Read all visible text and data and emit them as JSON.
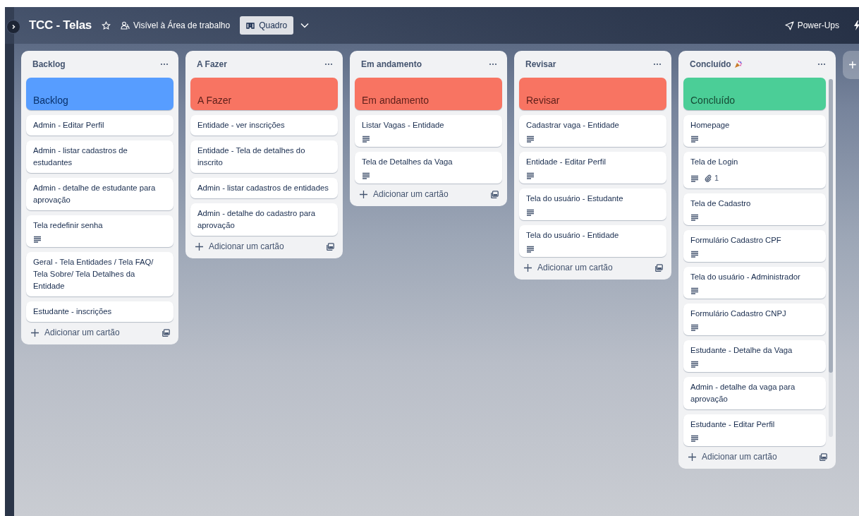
{
  "board": {
    "title": "TCC - Telas",
    "visibility": "Visível à Área de trabalho",
    "view": "Quadro",
    "power_ups": "Power-Ups"
  },
  "lists": [
    {
      "title": "Backlog",
      "celebration_icon": false,
      "scrollbar": false,
      "add_label": "Adicionar um cartão",
      "cards": [
        {
          "kind": "cover",
          "title": "Backlog",
          "color": "#579dff"
        },
        {
          "kind": "task",
          "title": "Admin - Editar Perfil",
          "description": false
        },
        {
          "kind": "task",
          "title": "Admin - listar cadastros de estudantes",
          "description": false
        },
        {
          "kind": "task",
          "title": "Admin - detalhe de estudante para aprovação",
          "description": false
        },
        {
          "kind": "task",
          "title": "Tela redefinir senha",
          "description": true
        },
        {
          "kind": "task",
          "title": "Geral - Tela Entidades / Tela FAQ/ Tela Sobre/ Tela Detalhes da Entidade",
          "description": false
        },
        {
          "kind": "task",
          "title": "Estudante - inscrições",
          "description": false
        }
      ]
    },
    {
      "title": "A Fazer",
      "celebration_icon": false,
      "scrollbar": false,
      "add_label": "Adicionar um cartão",
      "cards": [
        {
          "kind": "cover",
          "title": "A Fazer",
          "color": "#f87462"
        },
        {
          "kind": "task",
          "title": "Entidade - ver inscrições",
          "description": false
        },
        {
          "kind": "task",
          "title": "Entidade - Tela de detalhes do inscrito",
          "description": false
        },
        {
          "kind": "task",
          "title": "Admin - listar cadastros de entidades",
          "description": false
        },
        {
          "kind": "task",
          "title": "Admin - detalhe do cadastro para aprovação",
          "description": false
        }
      ]
    },
    {
      "title": "Em andamento",
      "celebration_icon": false,
      "scrollbar": false,
      "add_label": "Adicionar um cartão",
      "cards": [
        {
          "kind": "cover",
          "title": "Em andamento",
          "color": "#f87462"
        },
        {
          "kind": "task",
          "title": "Listar Vagas - Entidade",
          "description": true
        },
        {
          "kind": "task",
          "title": "Tela de Detalhes da Vaga",
          "description": true
        }
      ]
    },
    {
      "title": "Revisar",
      "celebration_icon": false,
      "scrollbar": false,
      "add_label": "Adicionar um cartão",
      "cards": [
        {
          "kind": "cover",
          "title": "Revisar",
          "color": "#f87462"
        },
        {
          "kind": "task",
          "title": "Cadastrar vaga - Entidade",
          "description": true
        },
        {
          "kind": "task",
          "title": "Entidade - Editar Perfil",
          "description": true
        },
        {
          "kind": "task",
          "title": "Tela do usuário - Estudante",
          "description": true
        },
        {
          "kind": "task",
          "title": "Tela do usuário - Entidade",
          "description": true
        }
      ]
    },
    {
      "title": "Concluído",
      "celebration_icon": true,
      "scrollbar": true,
      "add_label": "Adicionar um cartão",
      "cards": [
        {
          "kind": "cover",
          "title": "Concluído",
          "color": "#4bce97"
        },
        {
          "kind": "task",
          "title": "Homepage",
          "description": true
        },
        {
          "kind": "task",
          "title": "Tela de Login",
          "description": true,
          "attachments": "1"
        },
        {
          "kind": "task",
          "title": "Tela de Cadastro",
          "description": true
        },
        {
          "kind": "task",
          "title": "Formulário Cadastro CPF",
          "description": true
        },
        {
          "kind": "task",
          "title": "Tela do usuário - Administrador",
          "description": true
        },
        {
          "kind": "task",
          "title": "Formulário Cadastro CNPJ",
          "description": true
        },
        {
          "kind": "task",
          "title": "Estudante - Detalhe da Vaga",
          "description": true
        },
        {
          "kind": "task",
          "title": "Admin - detalhe da vaga para aprovação",
          "description": false
        },
        {
          "kind": "task",
          "title": "Estudante - Editar Perfil",
          "description": true
        }
      ]
    }
  ],
  "add_list": "+"
}
